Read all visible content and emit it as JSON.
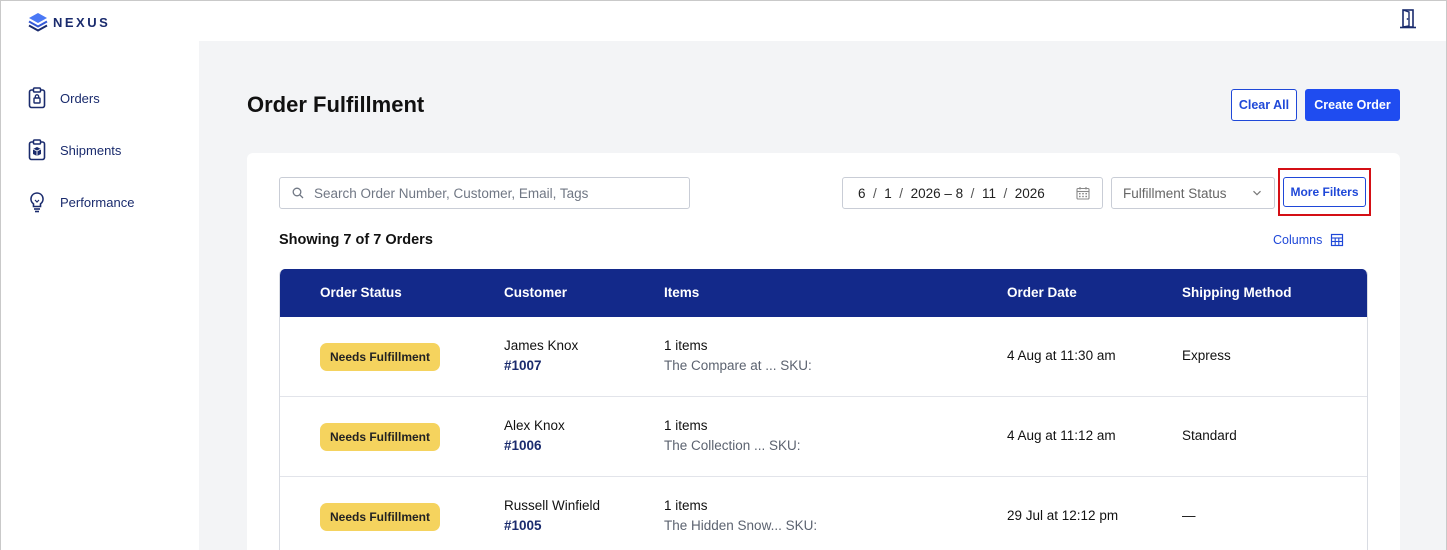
{
  "app": {
    "brand": "NEXUS"
  },
  "sidebar": {
    "items": [
      {
        "label": "Orders",
        "icon": "clipboard-icon"
      },
      {
        "label": "Shipments",
        "icon": "package-clipboard-icon"
      },
      {
        "label": "Performance",
        "icon": "lightbulb-icon"
      }
    ]
  },
  "page": {
    "title": "Order Fulfillment",
    "clear_all_label": "Clear All",
    "create_order_label": "Create Order"
  },
  "filters": {
    "search_placeholder": "Search Order Number, Customer, Email, Tags",
    "date_range": {
      "start_month": "6",
      "start_day": "1",
      "start_year": "2026",
      "separator": "–",
      "end_month": "8",
      "end_day": "11",
      "end_year": "2026"
    },
    "fulfillment_status_label": "Fulfillment Status",
    "more_filters_label": "More Filters"
  },
  "summary": {
    "showing_text": "Showing 7 of 7 Orders",
    "columns_label": "Columns"
  },
  "table": {
    "headers": [
      "Order Status",
      "Customer",
      "Items",
      "Order Date",
      "Shipping Method"
    ],
    "rows": [
      {
        "status": "Needs Fulfillment",
        "customer": "James Knox",
        "order_number": "#1007",
        "items_count": "1 items",
        "items_desc": "The Compare at ... SKU:",
        "order_date": "4 Aug at 11:30 am",
        "shipping": "Express"
      },
      {
        "status": "Needs Fulfillment",
        "customer": "Alex Knox",
        "order_number": "#1006",
        "items_count": "1 items",
        "items_desc": "The Collection ... SKU:",
        "order_date": "4 Aug at 11:12 am",
        "shipping": "Standard"
      },
      {
        "status": "Needs Fulfillment",
        "customer": "Russell Winfield",
        "order_number": "#1005",
        "items_count": "1 items",
        "items_desc": "The Hidden Snow... SKU:",
        "order_date": "29 Jul at 12:12 pm",
        "shipping": "—"
      }
    ]
  },
  "colors": {
    "brand_navy": "#13298a",
    "primary_blue": "#1f4cf0",
    "badge_yellow": "#f5d35e",
    "highlight_red": "#d40f15"
  }
}
